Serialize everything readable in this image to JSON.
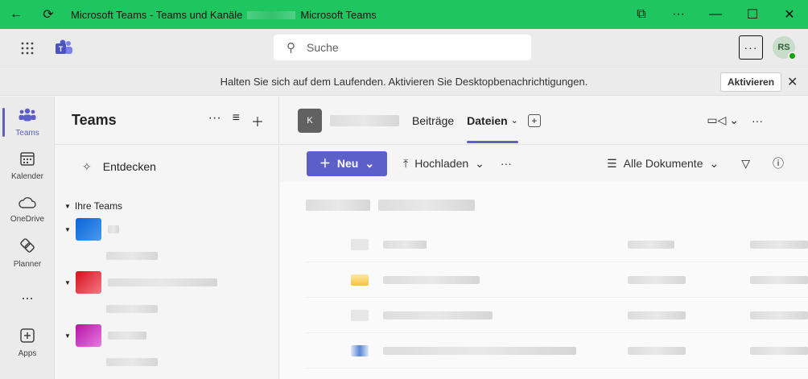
{
  "window": {
    "title_prefix": "Microsoft Teams - Teams und Kanäle",
    "title_suffix": "Microsoft Teams",
    "accent": "#1fc55f"
  },
  "header": {
    "search_placeholder": "Suche",
    "avatar_initials": "RS"
  },
  "banner": {
    "message": "Halten Sie sich auf dem Laufenden. Aktivieren Sie Desktopbenachrichtigungen.",
    "activate_label": "Aktivieren"
  },
  "rail": {
    "items": [
      {
        "label": "Teams",
        "icon": "teams-icon",
        "active": true
      },
      {
        "label": "Kalender",
        "icon": "calendar-icon"
      },
      {
        "label": "OneDrive",
        "icon": "cloud-icon"
      },
      {
        "label": "Planner",
        "icon": "planner-icon"
      },
      {
        "label": "...",
        "icon": "more-icon"
      },
      {
        "label": "Apps",
        "icon": "apps-icon"
      }
    ]
  },
  "panel": {
    "title": "Teams",
    "discover_label": "Entdecken",
    "section_label": "Ihre Teams",
    "team_colors": [
      "#1a73e8",
      "#e01b24",
      "#c21bb8"
    ]
  },
  "main": {
    "channel_initial": "K",
    "tabs": [
      "Beiträge",
      "Dateien"
    ],
    "active_tab": "Dateien",
    "toolbar": {
      "new_label": "Neu",
      "upload_label": "Hochladen",
      "view_label": "Alle Dokumente"
    }
  }
}
